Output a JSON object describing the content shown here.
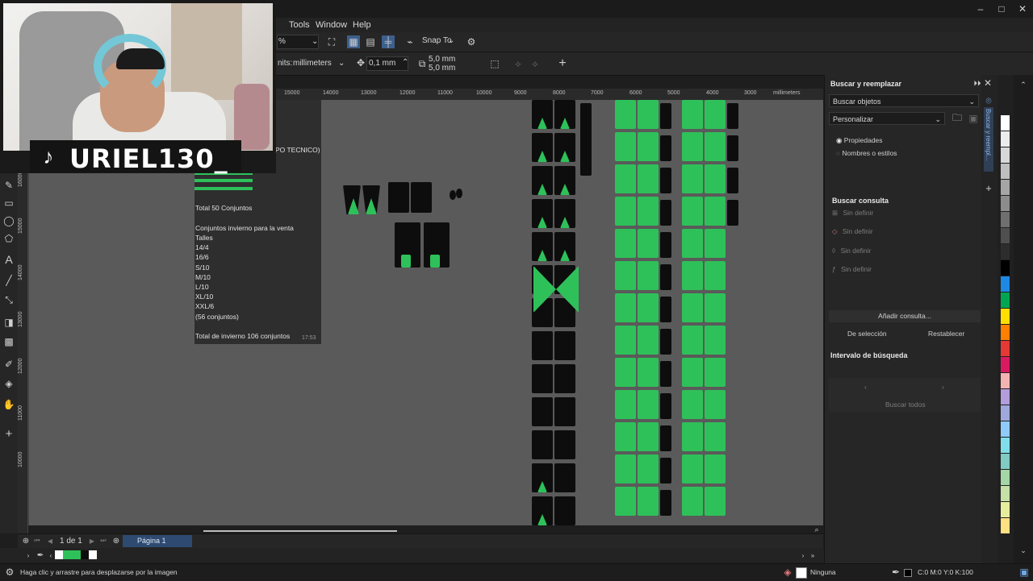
{
  "menubar": {
    "items": [
      "Tools",
      "Window",
      "Help"
    ]
  },
  "toolbar1": {
    "zoom_fragment": "%",
    "snap_to": "Snap To"
  },
  "toolbar2": {
    "units_label": "nits:",
    "units_value": "millimeters",
    "nudge": "0,1 mm",
    "dup_x": "5,0 mm",
    "dup_y": "5,0 mm"
  },
  "ruler_top": {
    "labels": [
      "15000",
      "14000",
      "13000",
      "12000",
      "11000",
      "10000",
      "9000",
      "8000",
      "7000",
      "6000",
      "5000",
      "4000",
      "3000",
      "millimeters"
    ]
  },
  "ruler_left": {
    "labels": [
      "17000",
      "16000",
      "15000",
      "14000",
      "13000",
      "12000",
      "11000",
      "10000"
    ]
  },
  "notes": {
    "cut_text": "PO TECNICO)",
    "total_conjuntos": "Total 50 Conjuntos",
    "invierno_title": "Conjuntos invierno para la venta",
    "talles": "Talles",
    "sizes": [
      "14/4",
      "16/6",
      "S/10",
      "M/10",
      "L/10",
      "XL/10",
      "XXL/6"
    ],
    "subtotal": "(56 conjuntos)",
    "total_invierno": "Total de invierno 106 conjuntos",
    "time": "17:53"
  },
  "docker": {
    "title": "Buscar y reemplazar",
    "mode": "Buscar objetos",
    "preset": "Personalizar",
    "radio_props": "Propiedades",
    "radio_names": "Nombres o estilos",
    "query_title": "Buscar consulta",
    "query_rows": [
      "Sin definir",
      "Sin definir",
      "Sin definir",
      "Sin definir"
    ],
    "add_query": "Añadir consulta...",
    "from_selection": "De selección",
    "reset": "Restablecer",
    "range_title": "Intervalo de búsqueda",
    "search_all": "Buscar todos",
    "tab_label": "Buscar y reempl..."
  },
  "pagebar": {
    "page_count": "1 de 1",
    "page_tab": "Página 1"
  },
  "statusbar": {
    "hint": "Haga clic y arrastre para desplazarse por la imagen",
    "fill": "Ninguna",
    "outline": "C:0 M:0 Y:0 K:100"
  },
  "webcam": {
    "handle": "URIEL130_"
  },
  "colors": {
    "green": "#2ec15a",
    "black": "#0d0d0d",
    "canvas": "#5a5a5a",
    "accent": "#3d7fd1"
  },
  "palette": [
    "#ffffff",
    "#ececec",
    "#d8d8d8",
    "#bfbfbf",
    "#a5a5a5",
    "#8c8c8c",
    "#6f6f6f",
    "#4f4f4f",
    "#2d2d2d",
    "#000000",
    "#1e88e5",
    "#00a651",
    "#ffde00",
    "#ff7f00",
    "#e53935",
    "#d81b60",
    "#f3b2b2",
    "#b39ddb",
    "#9fa8da",
    "#90caf9",
    "#80deea",
    "#80cbc4",
    "#a5d6a7",
    "#c5e1a5",
    "#e6ee9c",
    "#ffe082"
  ]
}
